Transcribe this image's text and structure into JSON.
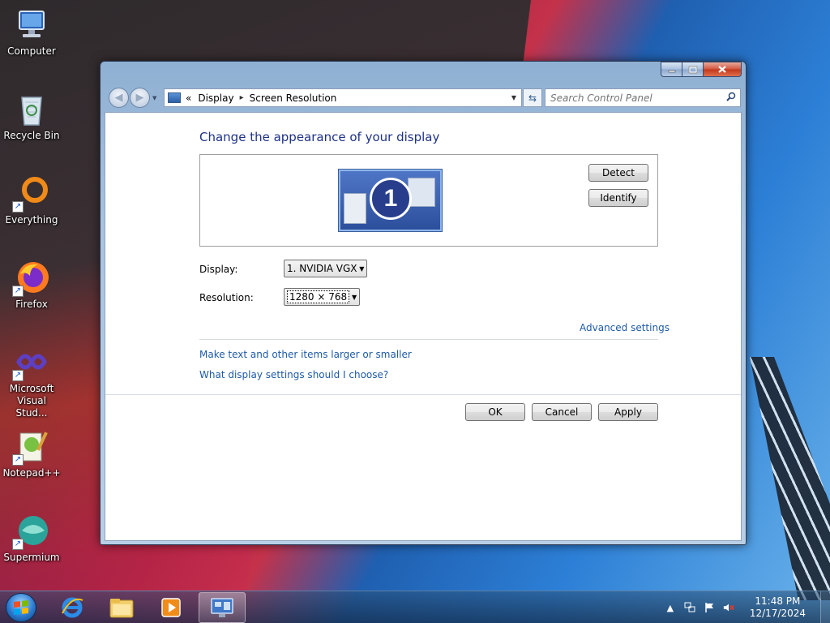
{
  "desktop": {
    "icons": [
      {
        "label": "Computer"
      },
      {
        "label": "Recycle Bin"
      },
      {
        "label": "Everything"
      },
      {
        "label": "Firefox"
      },
      {
        "label": "Microsoft Visual Stud..."
      },
      {
        "label": "Notepad++"
      },
      {
        "label": "Supermium"
      }
    ]
  },
  "window": {
    "breadcrumb": {
      "root_chevron": "«",
      "items": [
        "Display",
        "Screen Resolution"
      ],
      "separator": "▸"
    },
    "search": {
      "placeholder": "Search Control Panel"
    },
    "page_title": "Change the appearance of your display",
    "monitor_number": "1",
    "buttons": {
      "detect": "Detect",
      "identify": "Identify",
      "ok": "OK",
      "cancel": "Cancel",
      "apply": "Apply"
    },
    "display": {
      "label": "Display:",
      "value": "1. NVIDIA VGX"
    },
    "resolution": {
      "label": "Resolution:",
      "value": "1280 × 768"
    },
    "links": {
      "advanced": "Advanced settings",
      "text_size": "Make text and other items larger or smaller",
      "help": "What display settings should I choose?"
    }
  },
  "taskbar": {
    "clock": {
      "time": "11:48 PM",
      "date": "12/17/2024"
    }
  },
  "colors": {
    "link": "#1e5aa8",
    "title": "#1e3287",
    "close_button": "#c13619"
  }
}
